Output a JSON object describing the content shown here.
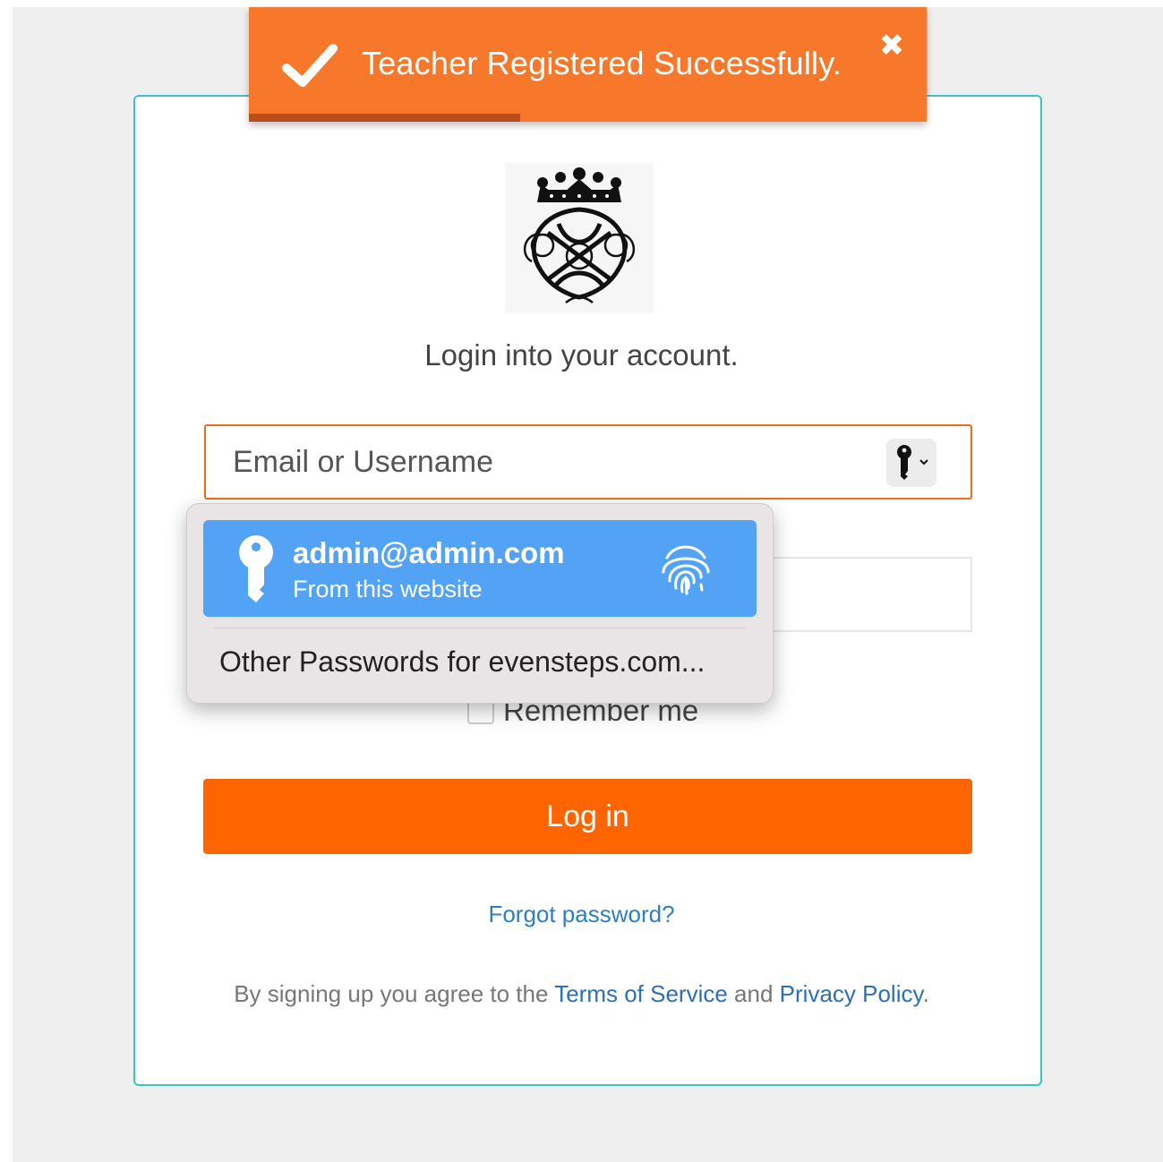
{
  "toast": {
    "message": "Teacher Registered Successfully.",
    "close_glyph": "✖",
    "progress_percent": 40,
    "icons": {
      "status": "checkmark-icon",
      "close": "close-icon"
    }
  },
  "logo": {
    "icon": "royal-crest-monogram-icon"
  },
  "login": {
    "subtitle": "Login into your account.",
    "email_placeholder": "Email or Username",
    "key_icon": "key-dropdown-icon",
    "remember_label": "Remember me",
    "login_button": "Log in",
    "forgot_link": "Forgot password?",
    "terms": {
      "prefix": "By signing up you agree to the",
      "tos_link": "Terms of Service",
      "and": "and",
      "privacy_link": "Privacy Policy",
      "suffix": "."
    }
  },
  "autofill": {
    "suggestion": {
      "username": "admin@admin.com",
      "source": "From this website",
      "icons": {
        "key": "key-icon",
        "fingerprint": "fingerprint-icon"
      }
    },
    "other_passwords": "Other Passwords for evensteps.com..."
  },
  "colors": {
    "accent": "#fe6500",
    "toast": "#f7772b",
    "card_border": "#3cc3c6",
    "link": "#2d7fc1",
    "autofill_highlight": "#52a3f5"
  }
}
